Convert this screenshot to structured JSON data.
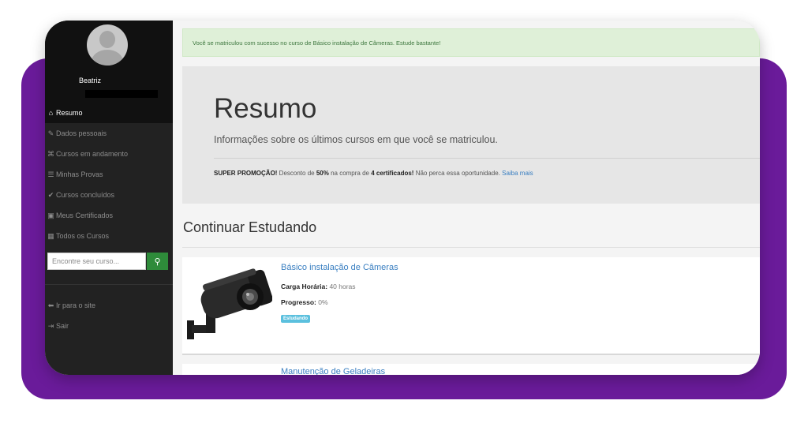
{
  "user": {
    "name": "Beatriz"
  },
  "sidebar": {
    "items": [
      {
        "label": "Resumo",
        "icon": "home-icon",
        "glyph": "⌂",
        "active": true
      },
      {
        "label": "Dados pessoais",
        "icon": "pencil-icon",
        "glyph": "✎"
      },
      {
        "label": "Cursos em andamento",
        "icon": "graduation-cap-icon",
        "glyph": "⌘"
      },
      {
        "label": "Minhas Provas",
        "icon": "list-icon",
        "glyph": "☰"
      },
      {
        "label": "Cursos concluídos",
        "icon": "check-icon",
        "glyph": "✔"
      },
      {
        "label": "Meus Certificados",
        "icon": "inbox-icon",
        "glyph": "▣"
      },
      {
        "label": "Todos os Cursos",
        "icon": "grid-icon",
        "glyph": "▦"
      }
    ],
    "search_placeholder": "Encontre seu curso...",
    "search_icon": "search-icon",
    "bottom": [
      {
        "label": "Ir para o site",
        "icon": "arrow-left-icon",
        "glyph": "⬅"
      },
      {
        "label": "Sair",
        "icon": "sign-out-icon",
        "glyph": "⇥"
      }
    ]
  },
  "alert": {
    "text": "Você se matriculou com sucesso no curso de Básico instalação de Câmeras. Estude bastante!"
  },
  "summary": {
    "title": "Resumo",
    "subtitle": "Informações sobre os últimos cursos em que você se matriculou.",
    "promo_lead": "SUPER PROMOÇÃO!",
    "promo_text1": " Desconto de ",
    "promo_discount": "50%",
    "promo_text2": " na compra de ",
    "promo_bold": "4 certificados!",
    "promo_text3": " Não perca essa oportunidade. ",
    "promo_link": "Saiba mais"
  },
  "continue": {
    "title": "Continuar Estudando",
    "courses": [
      {
        "title": "Básico instalação de Câmeras",
        "workload_label": "Carga Horária:",
        "workload_value": "40 horas",
        "progress_label": "Progresso:",
        "progress_value": "0%",
        "status": "Estudando"
      },
      {
        "title": "Manutenção de Geladeiras"
      }
    ]
  },
  "colors": {
    "accent": "#6a1b9a",
    "sidebar": "#222222",
    "link": "#3a7fc1",
    "badge": "#5bc0de",
    "search_button": "#2e8b3a"
  }
}
